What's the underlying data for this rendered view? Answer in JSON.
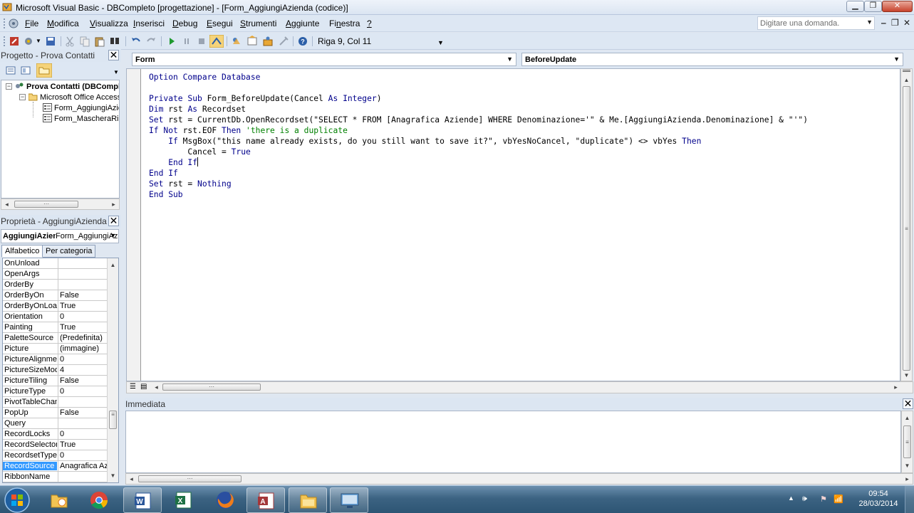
{
  "window": {
    "title": "Microsoft Visual Basic - DBCompleto [progettazione] - [Form_AggiungiAzienda (codice)]",
    "min_btn": "▁",
    "max_btn": "❐",
    "close_btn": "✕"
  },
  "menu": {
    "items": [
      "File",
      "Modifica",
      "Visualizza",
      "Inserisci",
      "Debug",
      "Esegui",
      "Strumenti",
      "Aggiunte",
      "Finestra",
      "?"
    ],
    "help_placeholder": "Digitare una domanda.",
    "mdi_controls": [
      "‒",
      "❐",
      "✕"
    ]
  },
  "toolbar": {
    "cursor_position": "Riga 9, Col 11"
  },
  "project": {
    "title": "Progetto - Prova Contatti",
    "close": "✕",
    "tree": [
      {
        "label": "Prova Contatti (DBCompleto)",
        "level": 0,
        "bold": true
      },
      {
        "label": "Microsoft Office Access Oggetti classe",
        "level": 1,
        "bold": false
      },
      {
        "label": "Form_AggiungiAzienda",
        "level": 2,
        "bold": false
      },
      {
        "label": "Form_MascheraRicerca",
        "level": 2,
        "bold": false
      }
    ]
  },
  "properties": {
    "title": "Proprietà - AggiungiAzienda",
    "close": "✕",
    "object_name": "AggiungiAzienda",
    "object_type": "Form_AggiungiAzienda",
    "tabs": [
      "Alfabetico",
      "Per categoria"
    ],
    "active_tab": "Alfabetico",
    "rows": [
      {
        "name": "OnUnload",
        "value": ""
      },
      {
        "name": "OpenArgs",
        "value": ""
      },
      {
        "name": "OrderBy",
        "value": ""
      },
      {
        "name": "OrderByOn",
        "value": "False"
      },
      {
        "name": "OrderByOnLoad",
        "value": "True"
      },
      {
        "name": "Orientation",
        "value": "0"
      },
      {
        "name": "Painting",
        "value": "True"
      },
      {
        "name": "PaletteSource",
        "value": "(Predefinita)"
      },
      {
        "name": "Picture",
        "value": "(immagine)"
      },
      {
        "name": "PictureAlignment",
        "value": "0"
      },
      {
        "name": "PictureSizeMode",
        "value": "4"
      },
      {
        "name": "PictureTiling",
        "value": "False"
      },
      {
        "name": "PictureType",
        "value": "0"
      },
      {
        "name": "PivotTableChange",
        "value": ""
      },
      {
        "name": "PopUp",
        "value": "False"
      },
      {
        "name": "Query",
        "value": ""
      },
      {
        "name": "RecordLocks",
        "value": "0"
      },
      {
        "name": "RecordSelectors",
        "value": "True"
      },
      {
        "name": "RecordsetType",
        "value": "0"
      },
      {
        "name": "RecordSource",
        "value": "Anagrafica Aziende",
        "selected": true
      },
      {
        "name": "RibbonName",
        "value": ""
      }
    ]
  },
  "code": {
    "object_combo": "Form",
    "procedure_combo": "BeforeUpdate",
    "lines": [
      [
        {
          "t": "Option Compare Database",
          "c": "kw"
        }
      ],
      [],
      [
        {
          "t": "Private Sub ",
          "c": "kw"
        },
        {
          "t": "Form_BeforeUpdate(Cancel "
        },
        {
          "t": "As Integer",
          "c": "kw"
        },
        {
          "t": ")"
        }
      ],
      [
        {
          "t": "Dim ",
          "c": "kw"
        },
        {
          "t": "rst "
        },
        {
          "t": "As ",
          "c": "kw"
        },
        {
          "t": "Recordset"
        }
      ],
      [
        {
          "t": "Set ",
          "c": "kw"
        },
        {
          "t": "rst = CurrentDb.OpenRecordset(\"SELECT * FROM [Anagrafica Aziende] WHERE Denominazione='\" & Me.[AggiungiAzienda.Denominazione] & \"'\")"
        }
      ],
      [
        {
          "t": "If Not ",
          "c": "kw"
        },
        {
          "t": "rst.EOF "
        },
        {
          "t": "Then ",
          "c": "kw"
        },
        {
          "t": "'there is a duplicate",
          "c": "cm"
        }
      ],
      [
        {
          "t": "    "
        },
        {
          "t": "If ",
          "c": "kw"
        },
        {
          "t": "MsgBox(\"this name already exists, do you still want to save it?\", vbYesNoCancel, \"duplicate\") <> vbYes "
        },
        {
          "t": "Then",
          "c": "kw"
        }
      ],
      [
        {
          "t": "        Cancel = "
        },
        {
          "t": "True",
          "c": "kw"
        }
      ],
      [
        {
          "t": "    "
        },
        {
          "t": "End If",
          "c": "kw"
        }
      ],
      [
        {
          "t": "End If",
          "c": "kw"
        }
      ],
      [
        {
          "t": "Set ",
          "c": "kw"
        },
        {
          "t": "rst = "
        },
        {
          "t": "Nothing",
          "c": "kw"
        }
      ],
      [
        {
          "t": "End Sub",
          "c": "kw"
        }
      ]
    ]
  },
  "immediate": {
    "title": "Immediata",
    "close": "✕"
  },
  "taskbar": {
    "apps": [
      "Internet Explorer folder",
      "Google Chrome",
      "Microsoft Word",
      "Microsoft Excel",
      "Mozilla Firefox",
      "Microsoft Access",
      "Esplora risorse",
      "Desktop remoto"
    ],
    "time": "09:54",
    "date": "28/03/2014"
  }
}
